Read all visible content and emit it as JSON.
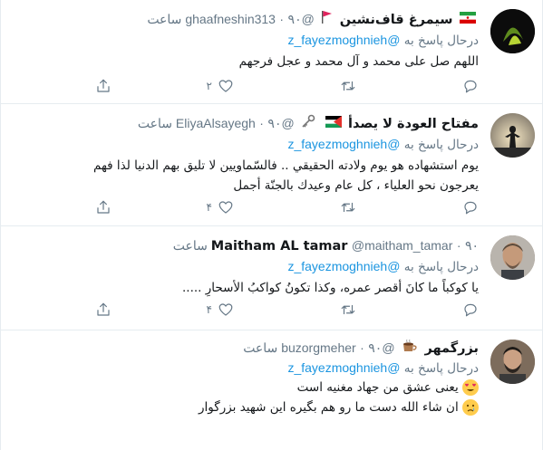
{
  "tweets": [
    {
      "name": "سیمرغ قاف‌نشین",
      "handle": "@ghaafneshin313",
      "dot": "·",
      "time": "۹۰ ساعت",
      "reply_prefix": "درحال پاسخ به",
      "reply_mention": "@z_fayezmoghnieh",
      "lines": [
        "اللهم صل علی محمد و آل محمد و عجل فرجهم"
      ],
      "counts": {
        "reply": "",
        "retweet": "",
        "like": "۲"
      },
      "flags": [
        "iran-flag",
        "red-flag"
      ]
    },
    {
      "name": "مفتاح العودة لا يصدأ",
      "handle": "@EliyaAlsayegh",
      "dot": "·",
      "time": "۹۰ ساعت",
      "reply_prefix": "درحال پاسخ به",
      "reply_mention": "@z_fayezmoghnieh",
      "lines": [
        "يوم استشهاده هو يوم ولادته الحقيقي .. فالسّماويين لا تليق بهم الدنيا لذا فهم",
        "يعرجون نحو العلياء ، كل عام وعيدك بالجنّة أجمل"
      ],
      "counts": {
        "reply": "",
        "retweet": "",
        "like": "۴"
      },
      "flags": [
        "key-icon",
        "palestine-flag"
      ]
    },
    {
      "name": "Maitham AL tamar",
      "handle": "@maitham_tamar",
      "dot": "·",
      "time": "۹۰ ساعت",
      "reply_prefix": "درحال پاسخ به",
      "reply_mention": "@z_fayezmoghnieh",
      "lines": [
        "يا كوكباً ما كانَ أقصر عمره، وكذا تكونُ كواكبُ الأسحارِ ....."
      ],
      "counts": {
        "reply": "",
        "retweet": "",
        "like": "۴"
      },
      "flags": []
    },
    {
      "name": "بزرگمهر",
      "handle": "@buzorgmeher",
      "dot": "·",
      "time": "۹۰ ساعت",
      "reply_prefix": "درحال پاسخ به",
      "reply_mention": "@z_fayezmoghnieh",
      "lines": [
        "یعنی عشق من جهاد مغنیه است",
        "ان شاء الله دست ما رو هم بگیره این شهید بزرگوار"
      ],
      "counts": {
        "reply": "",
        "retweet": "",
        "like": ""
      },
      "flags": [
        "coffee-icon"
      ],
      "emojis": [
        "heart-eyes-emoji",
        "crying-emoji"
      ]
    }
  ],
  "colors": {
    "accent": "#1b95e0",
    "muted": "#657786",
    "text": "#14171a",
    "border": "#e6ecf0"
  }
}
